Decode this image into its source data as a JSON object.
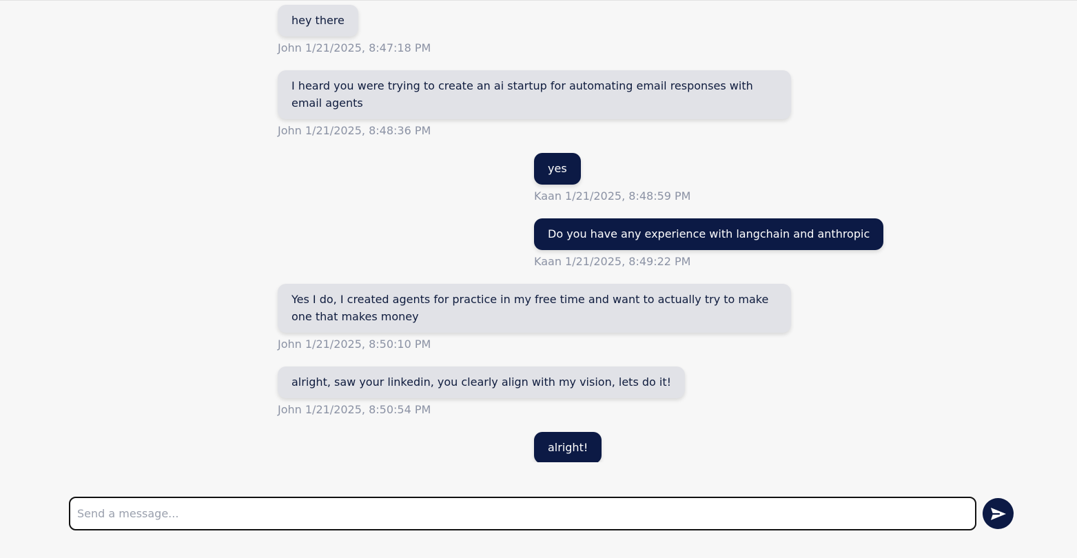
{
  "messages": [
    {
      "sender": "John",
      "text": "hey there",
      "meta": "John 1/21/2025, 8:47:18 PM",
      "direction": "in"
    },
    {
      "sender": "John",
      "text": "I heard you were trying to create an ai startup for automating email responses with email agents",
      "meta": "John 1/21/2025, 8:48:36 PM",
      "direction": "in"
    },
    {
      "sender": "Kaan",
      "text": "yes",
      "meta": "Kaan 1/21/2025, 8:48:59 PM",
      "direction": "out"
    },
    {
      "sender": "Kaan",
      "text": "Do you have any experience with langchain and anthropic",
      "meta": "Kaan 1/21/2025, 8:49:22 PM",
      "direction": "out"
    },
    {
      "sender": "John",
      "text": "Yes I do, I created agents for practice in my free time and want to actually try to make one that makes money",
      "meta": "John 1/21/2025, 8:50:10 PM",
      "direction": "in"
    },
    {
      "sender": "John",
      "text": "alright, saw your linkedin, you clearly align with my vision, lets do it!",
      "meta": "John 1/21/2025, 8:50:54 PM",
      "direction": "in"
    },
    {
      "sender": "Kaan",
      "text": "alright!",
      "meta": "",
      "direction": "out"
    }
  ],
  "composer": {
    "placeholder": "Send a message...",
    "value": ""
  },
  "send_button": {
    "icon": "send-icon"
  },
  "colors": {
    "background": "#f7f7f7",
    "incoming_bubble": "#e1e2e7",
    "outgoing_bubble": "#0c1a45",
    "meta_text": "#8b92a4"
  }
}
